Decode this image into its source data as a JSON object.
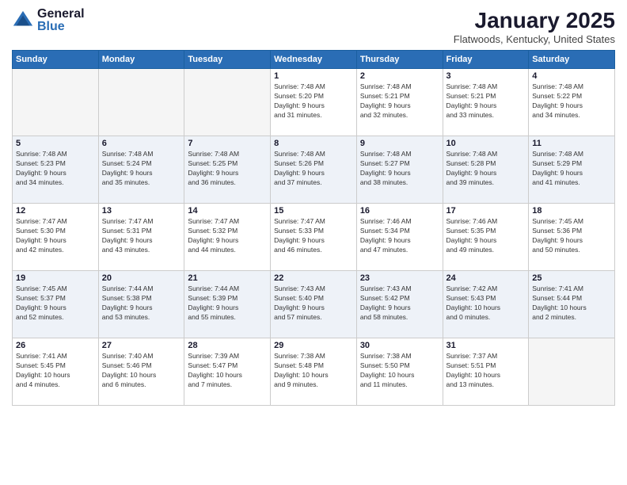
{
  "logo": {
    "general": "General",
    "blue": "Blue"
  },
  "header": {
    "month": "January 2025",
    "location": "Flatwoods, Kentucky, United States"
  },
  "days_of_week": [
    "Sunday",
    "Monday",
    "Tuesday",
    "Wednesday",
    "Thursday",
    "Friday",
    "Saturday"
  ],
  "weeks": [
    [
      {
        "day": "",
        "info": ""
      },
      {
        "day": "",
        "info": ""
      },
      {
        "day": "",
        "info": ""
      },
      {
        "day": "1",
        "info": "Sunrise: 7:48 AM\nSunset: 5:20 PM\nDaylight: 9 hours\nand 31 minutes."
      },
      {
        "day": "2",
        "info": "Sunrise: 7:48 AM\nSunset: 5:21 PM\nDaylight: 9 hours\nand 32 minutes."
      },
      {
        "day": "3",
        "info": "Sunrise: 7:48 AM\nSunset: 5:21 PM\nDaylight: 9 hours\nand 33 minutes."
      },
      {
        "day": "4",
        "info": "Sunrise: 7:48 AM\nSunset: 5:22 PM\nDaylight: 9 hours\nand 34 minutes."
      }
    ],
    [
      {
        "day": "5",
        "info": "Sunrise: 7:48 AM\nSunset: 5:23 PM\nDaylight: 9 hours\nand 34 minutes."
      },
      {
        "day": "6",
        "info": "Sunrise: 7:48 AM\nSunset: 5:24 PM\nDaylight: 9 hours\nand 35 minutes."
      },
      {
        "day": "7",
        "info": "Sunrise: 7:48 AM\nSunset: 5:25 PM\nDaylight: 9 hours\nand 36 minutes."
      },
      {
        "day": "8",
        "info": "Sunrise: 7:48 AM\nSunset: 5:26 PM\nDaylight: 9 hours\nand 37 minutes."
      },
      {
        "day": "9",
        "info": "Sunrise: 7:48 AM\nSunset: 5:27 PM\nDaylight: 9 hours\nand 38 minutes."
      },
      {
        "day": "10",
        "info": "Sunrise: 7:48 AM\nSunset: 5:28 PM\nDaylight: 9 hours\nand 39 minutes."
      },
      {
        "day": "11",
        "info": "Sunrise: 7:48 AM\nSunset: 5:29 PM\nDaylight: 9 hours\nand 41 minutes."
      }
    ],
    [
      {
        "day": "12",
        "info": "Sunrise: 7:47 AM\nSunset: 5:30 PM\nDaylight: 9 hours\nand 42 minutes."
      },
      {
        "day": "13",
        "info": "Sunrise: 7:47 AM\nSunset: 5:31 PM\nDaylight: 9 hours\nand 43 minutes."
      },
      {
        "day": "14",
        "info": "Sunrise: 7:47 AM\nSunset: 5:32 PM\nDaylight: 9 hours\nand 44 minutes."
      },
      {
        "day": "15",
        "info": "Sunrise: 7:47 AM\nSunset: 5:33 PM\nDaylight: 9 hours\nand 46 minutes."
      },
      {
        "day": "16",
        "info": "Sunrise: 7:46 AM\nSunset: 5:34 PM\nDaylight: 9 hours\nand 47 minutes."
      },
      {
        "day": "17",
        "info": "Sunrise: 7:46 AM\nSunset: 5:35 PM\nDaylight: 9 hours\nand 49 minutes."
      },
      {
        "day": "18",
        "info": "Sunrise: 7:45 AM\nSunset: 5:36 PM\nDaylight: 9 hours\nand 50 minutes."
      }
    ],
    [
      {
        "day": "19",
        "info": "Sunrise: 7:45 AM\nSunset: 5:37 PM\nDaylight: 9 hours\nand 52 minutes."
      },
      {
        "day": "20",
        "info": "Sunrise: 7:44 AM\nSunset: 5:38 PM\nDaylight: 9 hours\nand 53 minutes."
      },
      {
        "day": "21",
        "info": "Sunrise: 7:44 AM\nSunset: 5:39 PM\nDaylight: 9 hours\nand 55 minutes."
      },
      {
        "day": "22",
        "info": "Sunrise: 7:43 AM\nSunset: 5:40 PM\nDaylight: 9 hours\nand 57 minutes."
      },
      {
        "day": "23",
        "info": "Sunrise: 7:43 AM\nSunset: 5:42 PM\nDaylight: 9 hours\nand 58 minutes."
      },
      {
        "day": "24",
        "info": "Sunrise: 7:42 AM\nSunset: 5:43 PM\nDaylight: 10 hours\nand 0 minutes."
      },
      {
        "day": "25",
        "info": "Sunrise: 7:41 AM\nSunset: 5:44 PM\nDaylight: 10 hours\nand 2 minutes."
      }
    ],
    [
      {
        "day": "26",
        "info": "Sunrise: 7:41 AM\nSunset: 5:45 PM\nDaylight: 10 hours\nand 4 minutes."
      },
      {
        "day": "27",
        "info": "Sunrise: 7:40 AM\nSunset: 5:46 PM\nDaylight: 10 hours\nand 6 minutes."
      },
      {
        "day": "28",
        "info": "Sunrise: 7:39 AM\nSunset: 5:47 PM\nDaylight: 10 hours\nand 7 minutes."
      },
      {
        "day": "29",
        "info": "Sunrise: 7:38 AM\nSunset: 5:48 PM\nDaylight: 10 hours\nand 9 minutes."
      },
      {
        "day": "30",
        "info": "Sunrise: 7:38 AM\nSunset: 5:50 PM\nDaylight: 10 hours\nand 11 minutes."
      },
      {
        "day": "31",
        "info": "Sunrise: 7:37 AM\nSunset: 5:51 PM\nDaylight: 10 hours\nand 13 minutes."
      },
      {
        "day": "",
        "info": ""
      }
    ]
  ],
  "colors": {
    "header_bg": "#2a6db5",
    "row_even_bg": "#eef2f8",
    "row_odd_bg": "#ffffff",
    "empty_bg": "#f5f5f5"
  }
}
